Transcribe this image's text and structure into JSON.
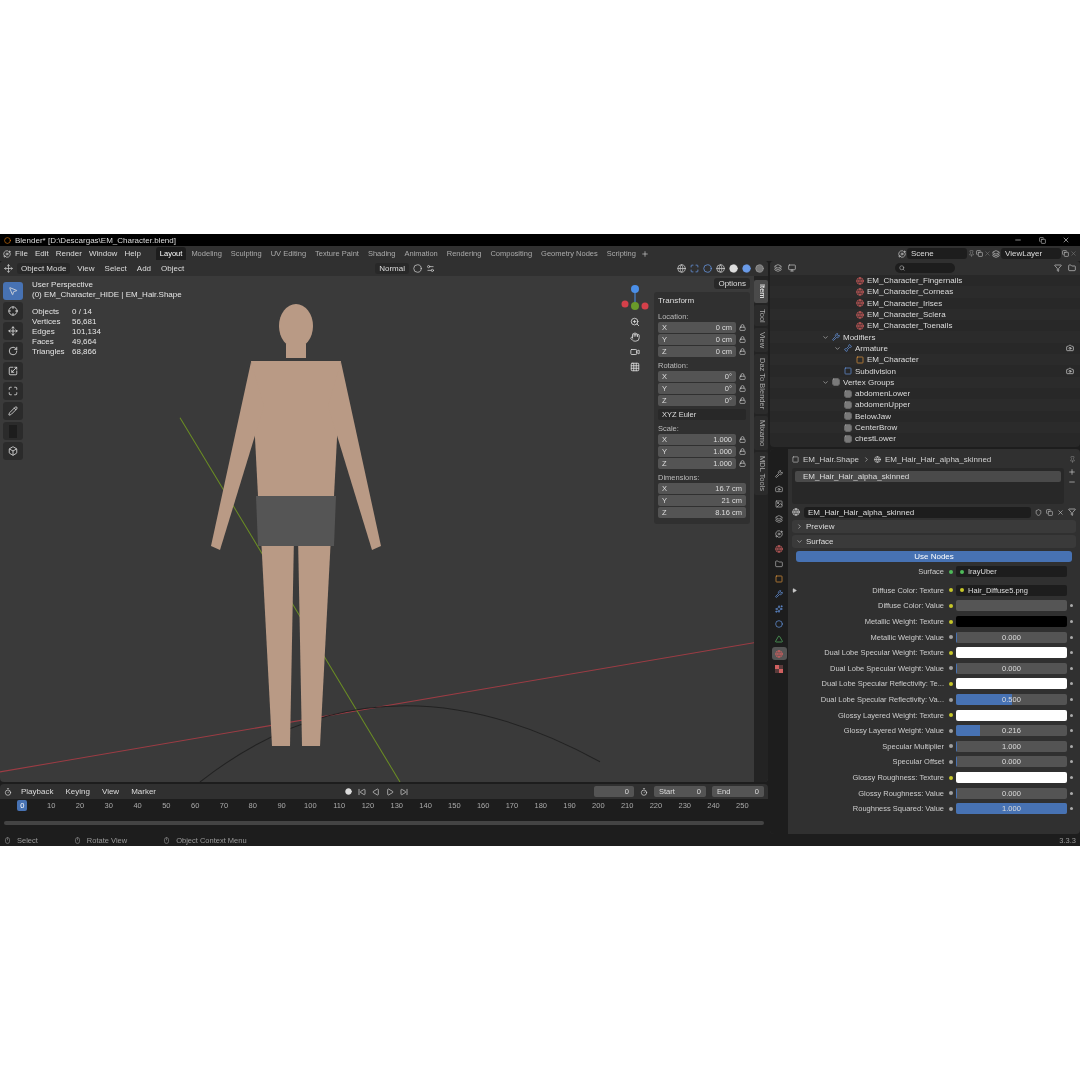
{
  "window": {
    "title": "Blender* [D:\\Descargas\\EM_Character.blend]"
  },
  "menu": [
    "File",
    "Edit",
    "Render",
    "Window",
    "Help"
  ],
  "workspaces": [
    {
      "label": "Layout",
      "selected": true
    },
    {
      "label": "Modeling",
      "selected": false
    },
    {
      "label": "Sculpting",
      "selected": false
    },
    {
      "label": "UV Editing",
      "selected": false
    },
    {
      "label": "Texture Paint",
      "selected": false
    },
    {
      "label": "Shading",
      "selected": false
    },
    {
      "label": "Animation",
      "selected": false
    },
    {
      "label": "Rendering",
      "selected": false
    },
    {
      "label": "Compositing",
      "selected": false
    },
    {
      "label": "Geometry Nodes",
      "selected": false
    },
    {
      "label": "Scripting",
      "selected": false
    }
  ],
  "scene": {
    "label": "Scene"
  },
  "view_layer": {
    "label": "ViewLayer"
  },
  "viewport": {
    "mode": "Object Mode",
    "menu": [
      "View",
      "Select",
      "Add",
      "Object"
    ],
    "orientation": "Normal",
    "options": "Options",
    "view_name": "User Perspective",
    "object_path": "(0) EM_Character_HIDE | EM_Hair.Shape",
    "stats": [
      {
        "label": "Objects",
        "value": "0 / 14"
      },
      {
        "label": "Vertices",
        "value": "56,681"
      },
      {
        "label": "Edges",
        "value": "101,134"
      },
      {
        "label": "Faces",
        "value": "49,664"
      },
      {
        "label": "Triangles",
        "value": "68,866"
      }
    ],
    "tools": [
      {
        "kind": "select",
        "selected": true
      },
      {
        "kind": "cursor",
        "selected": false
      },
      {
        "kind": "move",
        "selected": false
      },
      {
        "kind": "rotate",
        "selected": false
      },
      {
        "kind": "scale",
        "selected": false
      },
      {
        "kind": "transform",
        "selected": false
      },
      {
        "kind": "annotate",
        "selected": false
      },
      {
        "kind": "measure",
        "selected": false
      },
      {
        "kind": "add_cube",
        "selected": false
      }
    ]
  },
  "sidebar": {
    "tabs": [
      {
        "label": "Item",
        "selected": true
      },
      {
        "label": "Tool",
        "selected": false
      },
      {
        "label": "View",
        "selected": false
      },
      {
        "label": "Daz To Blender",
        "selected": false
      },
      {
        "label": "Mixamo",
        "selected": false
      },
      {
        "label": "MDL Tools",
        "selected": false
      }
    ],
    "panel": "Transform",
    "groups": [
      {
        "title": "Location:",
        "locks": true,
        "fields": [
          {
            "axis": "X",
            "value": "0 cm"
          },
          {
            "axis": "Y",
            "value": "0 cm"
          },
          {
            "axis": "Z",
            "value": "0 cm"
          }
        ]
      },
      {
        "title": "Rotation:",
        "locks": true,
        "fields": [
          {
            "axis": "X",
            "value": "0°"
          },
          {
            "axis": "Y",
            "value": "0°"
          },
          {
            "axis": "Z",
            "value": "0°"
          }
        ],
        "dropdown": "XYZ Euler"
      },
      {
        "title": "Scale:",
        "locks": true,
        "fields": [
          {
            "axis": "X",
            "value": "1.000"
          },
          {
            "axis": "Y",
            "value": "1.000"
          },
          {
            "axis": "Z",
            "value": "1.000"
          }
        ]
      },
      {
        "title": "Dimensions:",
        "locks": false,
        "fields": [
          {
            "axis": "X",
            "value": "16.7 cm"
          },
          {
            "axis": "Y",
            "value": "21 cm"
          },
          {
            "axis": "Z",
            "value": "8.16 cm"
          }
        ]
      }
    ]
  },
  "outliner": {
    "items": [
      {
        "label": "EM_Character_Fingernails",
        "kind": "material"
      },
      {
        "label": "EM_Character_Corneas",
        "kind": "material"
      },
      {
        "label": "EM_Character_Irises",
        "kind": "material"
      },
      {
        "label": "EM_Character_Sclera",
        "kind": "material"
      },
      {
        "label": "EM_Character_Toenails",
        "kind": "material"
      },
      {
        "label": "Modifiers",
        "kind": "modifiers",
        "expanded": true,
        "children": [
          {
            "label": "Armature",
            "kind": "armature",
            "expanded": true,
            "children": [
              {
                "label": "EM_Character",
                "kind": "object"
              }
            ]
          },
          {
            "label": "Subdivision",
            "kind": "subdivision"
          }
        ]
      },
      {
        "label": "Vertex Groups",
        "kind": "vertex_groups",
        "expanded": true,
        "children": [
          {
            "label": "abdomenLower",
            "kind": "vertex_group"
          },
          {
            "label": "abdomenUpper",
            "kind": "vertex_group"
          },
          {
            "label": "BelowJaw",
            "kind": "vertex_group"
          },
          {
            "label": "CenterBrow",
            "kind": "vertex_group"
          },
          {
            "label": "chestLower",
            "kind": "vertex_group"
          }
        ]
      }
    ]
  },
  "properties": {
    "tabs": [
      {
        "kind": "tool",
        "selected": false
      },
      {
        "kind": "render",
        "selected": false
      },
      {
        "kind": "output",
        "selected": false
      },
      {
        "kind": "view_layer",
        "selected": false
      },
      {
        "kind": "scene",
        "selected": false
      },
      {
        "kind": "world",
        "selected": false
      },
      {
        "kind": "collection",
        "selected": false
      },
      {
        "kind": "object",
        "selected": false
      },
      {
        "kind": "modifiers",
        "selected": false
      },
      {
        "kind": "particles",
        "selected": false
      },
      {
        "kind": "physics",
        "selected": false
      },
      {
        "kind": "data",
        "selected": false
      },
      {
        "kind": "material",
        "selected": true
      },
      {
        "kind": "texture",
        "selected": false
      }
    ],
    "breadcrumb": [
      "EM_Hair.Shape",
      "EM_Hair_Hair_alpha_skinned"
    ],
    "slots": [
      {
        "label": "EM_Hair_Hair_alpha_skinned",
        "selected": true
      }
    ],
    "material": "EM_Hair_Hair_alpha_skinned",
    "panels": [
      {
        "title": "Preview",
        "expanded": false
      },
      {
        "title": "Surface",
        "expanded": true
      }
    ],
    "use_nodes": "Use Nodes",
    "rows": [
      {
        "label": "Surface",
        "kind": "link",
        "color": "#4fbb5a",
        "value": "IrayUber"
      },
      {
        "label": "Diffuse Color: Texture",
        "kind": "link",
        "color": "#c7c729",
        "value": "Hair_Diffuse5.png",
        "expandable": true
      },
      {
        "label": "Diffuse Color: Value",
        "kind": "color",
        "color": "#555555"
      },
      {
        "label": "Metallic Weight: Texture",
        "kind": "color",
        "color": "#000000"
      },
      {
        "label": "Metallic Weight: Value",
        "kind": "slider",
        "level": 0,
        "reading": "0.000"
      },
      {
        "label": "Dual Lobe Specular Weight: Texture",
        "kind": "color",
        "color": "#ffffff"
      },
      {
        "label": "Dual Lobe Specular Weight: Value",
        "kind": "slider",
        "level": 0,
        "reading": "0.000"
      },
      {
        "label": "Dual Lobe Specular Reflectivity: Te...",
        "kind": "color",
        "color": "#ffffff"
      },
      {
        "label": "Dual Lobe Specular Reflectivity: Va...",
        "kind": "slider",
        "level": 0.5,
        "reading": "0.500"
      },
      {
        "label": "Glossy Layered Weight: Texture",
        "kind": "color",
        "color": "#ffffff"
      },
      {
        "label": "Glossy Layered Weight: Value",
        "kind": "slider",
        "level": 0.216,
        "reading": "0.216"
      },
      {
        "label": "Specular Multiplier",
        "kind": "slider",
        "level": 0.01,
        "reading": "1.000"
      },
      {
        "label": "Specular Offset",
        "kind": "slider",
        "level": 0,
        "reading": "0.000"
      },
      {
        "label": "Glossy Roughness: Texture",
        "kind": "color",
        "color": "#ffffff"
      },
      {
        "label": "Glossy Roughness: Value",
        "kind": "slider",
        "level": 0,
        "reading": "0.000"
      },
      {
        "label": "Roughness Squared: Value",
        "kind": "slider",
        "level": 1,
        "reading": "1.000"
      }
    ]
  },
  "timeline": {
    "menu": [
      "Playback",
      "Keying",
      "View",
      "Marker"
    ],
    "current_frame": "0",
    "start_label": "Start",
    "start": "0",
    "end_label": "End",
    "end": "0",
    "ticks": [
      {
        "label": "0",
        "selected": true
      },
      {
        "label": "10",
        "selected": false
      },
      {
        "label": "20",
        "selected": false
      },
      {
        "label": "30",
        "selected": false
      },
      {
        "label": "40",
        "selected": false
      },
      {
        "label": "50",
        "selected": false
      },
      {
        "label": "60",
        "selected": false
      },
      {
        "label": "70",
        "selected": false
      },
      {
        "label": "80",
        "selected": false
      },
      {
        "label": "90",
        "selected": false
      },
      {
        "label": "100",
        "selected": false
      },
      {
        "label": "110",
        "selected": false
      },
      {
        "label": "120",
        "selected": false
      },
      {
        "label": "130",
        "selected": false
      },
      {
        "label": "140",
        "selected": false
      },
      {
        "label": "150",
        "selected": false
      },
      {
        "label": "160",
        "selected": false
      },
      {
        "label": "170",
        "selected": false
      },
      {
        "label": "180",
        "selected": false
      },
      {
        "label": "190",
        "selected": false
      },
      {
        "label": "200",
        "selected": false
      },
      {
        "label": "210",
        "selected": false
      },
      {
        "label": "220",
        "selected": false
      },
      {
        "label": "230",
        "selected": false
      },
      {
        "label": "240",
        "selected": false
      },
      {
        "label": "250",
        "selected": false
      }
    ]
  },
  "status_bar": {
    "hints": [
      "Select",
      "Rotate View",
      "Object Context Menu"
    ],
    "version": "3.3.3"
  }
}
